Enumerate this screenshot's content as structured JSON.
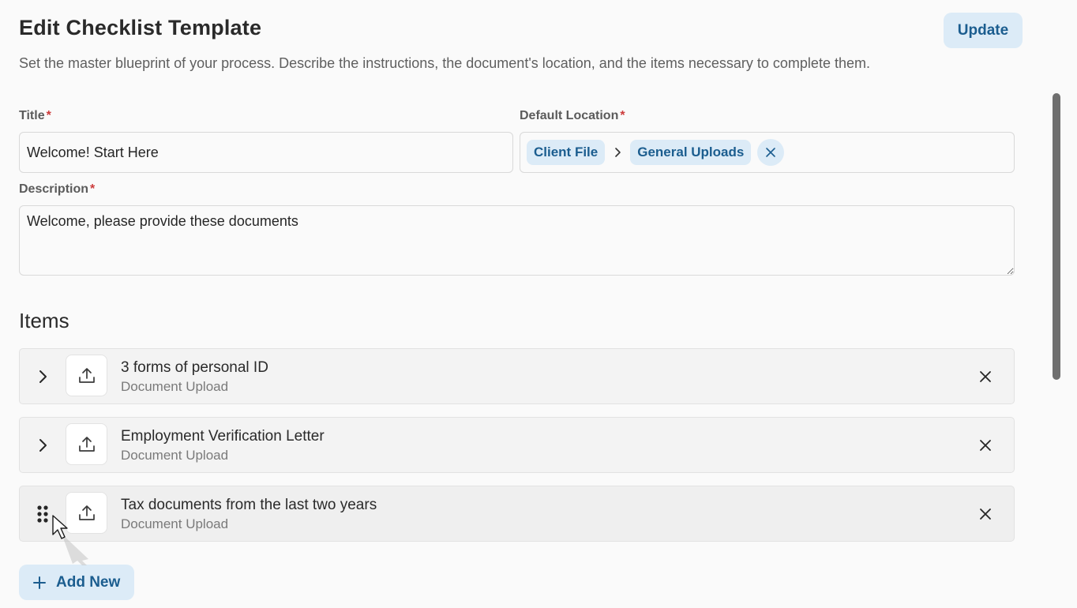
{
  "header": {
    "title": "Edit Checklist Template",
    "update_label": "Update",
    "subtitle": "Set the master blueprint of your process. Describe the instructions, the document's location, and the items necessary to complete them."
  },
  "form": {
    "title_label": "Title",
    "title_value": "Welcome! Start Here",
    "location_label": "Default Location",
    "location_path": [
      "Client File",
      "General Uploads"
    ],
    "description_label": "Description",
    "description_value": "Welcome, please provide these documents",
    "required_mark": "*"
  },
  "items_section": {
    "title": "Items",
    "items": [
      {
        "title": "3 forms of personal ID",
        "type": "Document Upload",
        "handle": "chevron-right-icon"
      },
      {
        "title": "Employment Verification Letter",
        "type": "Document Upload",
        "handle": "chevron-right-icon"
      },
      {
        "title": "Tax documents from the last two years",
        "type": "Document Upload",
        "handle": "drag-handle-icon"
      }
    ],
    "add_label": "Add New"
  },
  "colors": {
    "accent": "#1b5d8f",
    "accent_bg": "#dcebf7",
    "required": "#cc3b3b",
    "background": "#fafafa"
  }
}
